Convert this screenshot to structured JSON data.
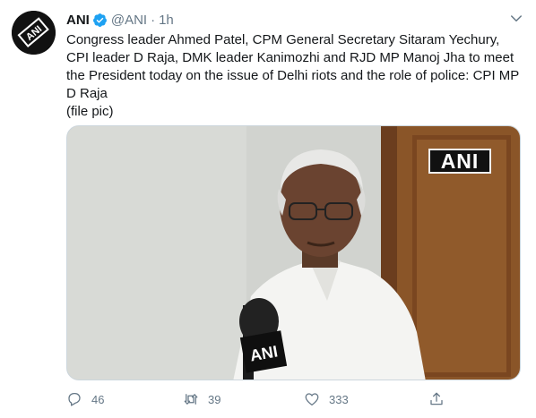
{
  "tweet": {
    "author_name": "ANI",
    "handle": "@ANI",
    "separator": "·",
    "time": "1h",
    "text_main": "Congress leader Ahmed Patel, CPM General Secretary Sitaram Yechury, CPI leader D Raja, DMK leader Kanimozhi and RJD MP Manoj Jha to meet the President today on the issue of Delhi riots and the role of police: CPI MP D Raja",
    "text_note": "(file pic)",
    "media_watermark": "ANI",
    "mic_label": "ANI",
    "avatar_text": "ANI"
  },
  "actions": {
    "replies": "46",
    "retweets": "39",
    "likes": "333"
  },
  "colors": {
    "verified": "#1da1f2",
    "muted": "#657786",
    "text": "#14171a"
  }
}
